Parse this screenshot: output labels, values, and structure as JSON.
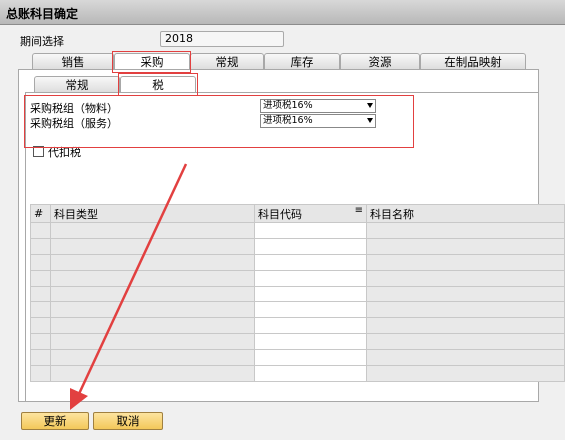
{
  "window": {
    "title": "总账科目确定"
  },
  "period": {
    "label": "期间选择",
    "value": "2018"
  },
  "main_tabs": [
    {
      "label": "销售"
    },
    {
      "label": "采购"
    },
    {
      "label": "常规"
    },
    {
      "label": "库存"
    },
    {
      "label": "资源"
    },
    {
      "label": "在制品映射"
    }
  ],
  "sub_tabs": [
    {
      "label": "常规"
    },
    {
      "label": "税"
    }
  ],
  "tax_rows": [
    {
      "label": "采购税组（物料）",
      "value": "进项税16%"
    },
    {
      "label": "采购税组（服务）",
      "value": "进项税16%"
    }
  ],
  "withholding": {
    "label": "代扣税"
  },
  "table": {
    "columns": [
      "#",
      "科目类型",
      "科目代码",
      "科目名称"
    ],
    "filter_icon": "≡"
  },
  "buttons": {
    "update": "更新",
    "cancel": "取消"
  },
  "colors": {
    "accent": "#e24040",
    "button": "#f3c85a"
  }
}
